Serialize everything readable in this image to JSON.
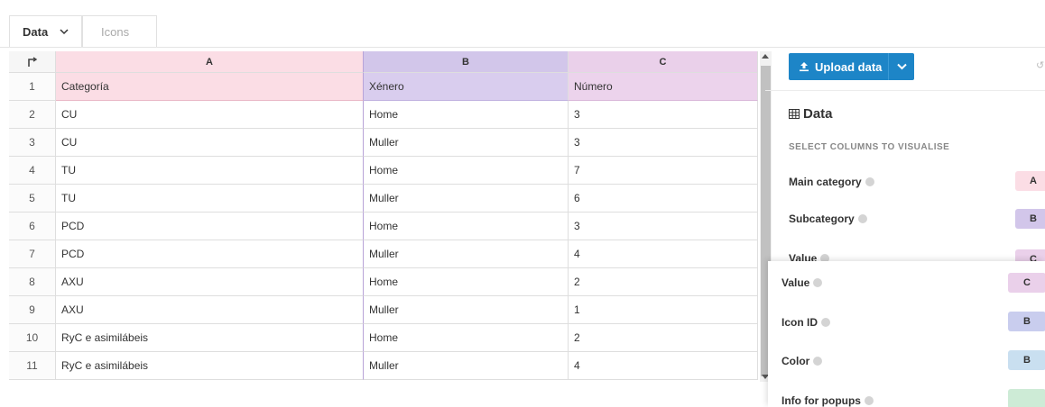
{
  "tabs": {
    "data_label": "Data",
    "icons_label": "Icons"
  },
  "grid": {
    "columns": [
      "A",
      "B",
      "C"
    ],
    "rows": [
      {
        "n": "1",
        "a": "Categoría",
        "b": "Xénero",
        "c": "Número"
      },
      {
        "n": "2",
        "a": "CU",
        "b": "Home",
        "c": "3"
      },
      {
        "n": "3",
        "a": "CU",
        "b": "Muller",
        "c": "3"
      },
      {
        "n": "4",
        "a": "TU",
        "b": "Home",
        "c": "7"
      },
      {
        "n": "5",
        "a": "TU",
        "b": "Muller",
        "c": "6"
      },
      {
        "n": "6",
        "a": "PCD",
        "b": "Home",
        "c": "3"
      },
      {
        "n": "7",
        "a": "PCD",
        "b": "Muller",
        "c": "4"
      },
      {
        "n": "8",
        "a": "AXU",
        "b": "Home",
        "c": "2"
      },
      {
        "n": "9",
        "a": "AXU",
        "b": "Muller",
        "c": "1"
      },
      {
        "n": "10",
        "a": "RyC e asimilábeis",
        "b": "Home",
        "c": "2"
      },
      {
        "n": "11",
        "a": "RyC e asimilábeis",
        "b": "Muller",
        "c": "4"
      }
    ]
  },
  "panel": {
    "upload_label": "Upload data",
    "section_title": "Data",
    "select_label": "SELECT COLUMNS TO VISUALISE",
    "fields": {
      "main_category": {
        "label": "Main category",
        "column": "A"
      },
      "subcategory": {
        "label": "Subcategory",
        "column": "B"
      },
      "value_partial": {
        "label": "Value",
        "column": "C"
      },
      "value": {
        "label": "Value",
        "column": "C"
      },
      "icon_id": {
        "label": "Icon ID",
        "column": "B"
      },
      "color": {
        "label": "Color",
        "column": "B"
      },
      "info_popups": {
        "label": "Info for popups",
        "column": ""
      }
    }
  },
  "colors": {
    "col_a": "#fbdde5",
    "col_b": "#d2c6ea",
    "col_c": "#ead0ea",
    "icon_pill": "#c9cdee",
    "color_pill": "#c9dff0",
    "info_pill": "#cdebd6",
    "accent": "#1d85c7"
  }
}
